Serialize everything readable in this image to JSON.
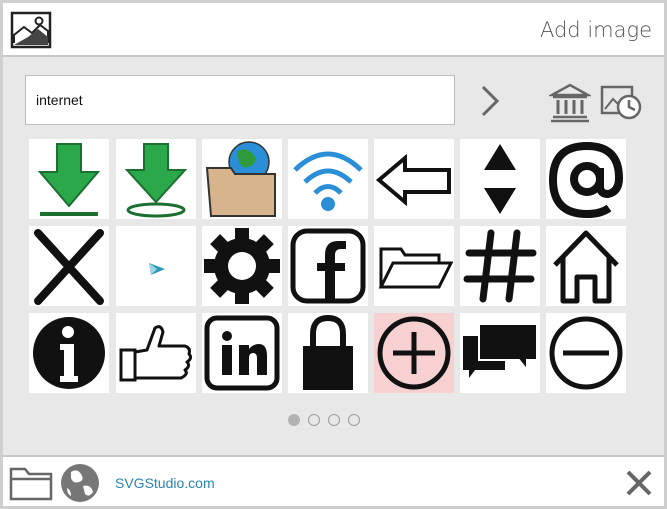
{
  "header": {
    "title": "Add image",
    "logo_icon": "image-icon"
  },
  "search": {
    "value": "internet",
    "go_icon": "chevron-right-icon"
  },
  "toolbar": {
    "library_icon": "library-icon",
    "history_icon": "history-icon"
  },
  "results": [
    {
      "icon": "download-arrow-icon"
    },
    {
      "icon": "download-circle-icon"
    },
    {
      "icon": "globe-folder-icon"
    },
    {
      "icon": "wifi-icon"
    },
    {
      "icon": "arrow-left-icon"
    },
    {
      "icon": "up-down-arrows-icon"
    },
    {
      "icon": "at-sign-icon"
    },
    {
      "icon": "x-mark-icon"
    },
    {
      "icon": "cursor-icon"
    },
    {
      "icon": "gear-icon"
    },
    {
      "icon": "facebook-icon"
    },
    {
      "icon": "open-folder-icon"
    },
    {
      "icon": "hashtag-icon"
    },
    {
      "icon": "home-icon"
    },
    {
      "icon": "info-icon"
    },
    {
      "icon": "thumbs-up-icon"
    },
    {
      "icon": "linkedin-icon"
    },
    {
      "icon": "padlock-icon"
    },
    {
      "icon": "plus-circle-icon",
      "highlighted": true
    },
    {
      "icon": "speech-bubbles-icon"
    },
    {
      "icon": "minus-circle-icon"
    }
  ],
  "pagination": {
    "pages": 4,
    "current": 1
  },
  "footer": {
    "site_link": "SVGStudio.com",
    "folder_icon": "folder-icon",
    "globe_icon": "globe-icon",
    "close_icon": "close-icon"
  },
  "colors": {
    "link": "#2b83b3",
    "highlight": "#f7d1d1",
    "green": "#2aa84a",
    "blue": "#2a8fd6"
  }
}
